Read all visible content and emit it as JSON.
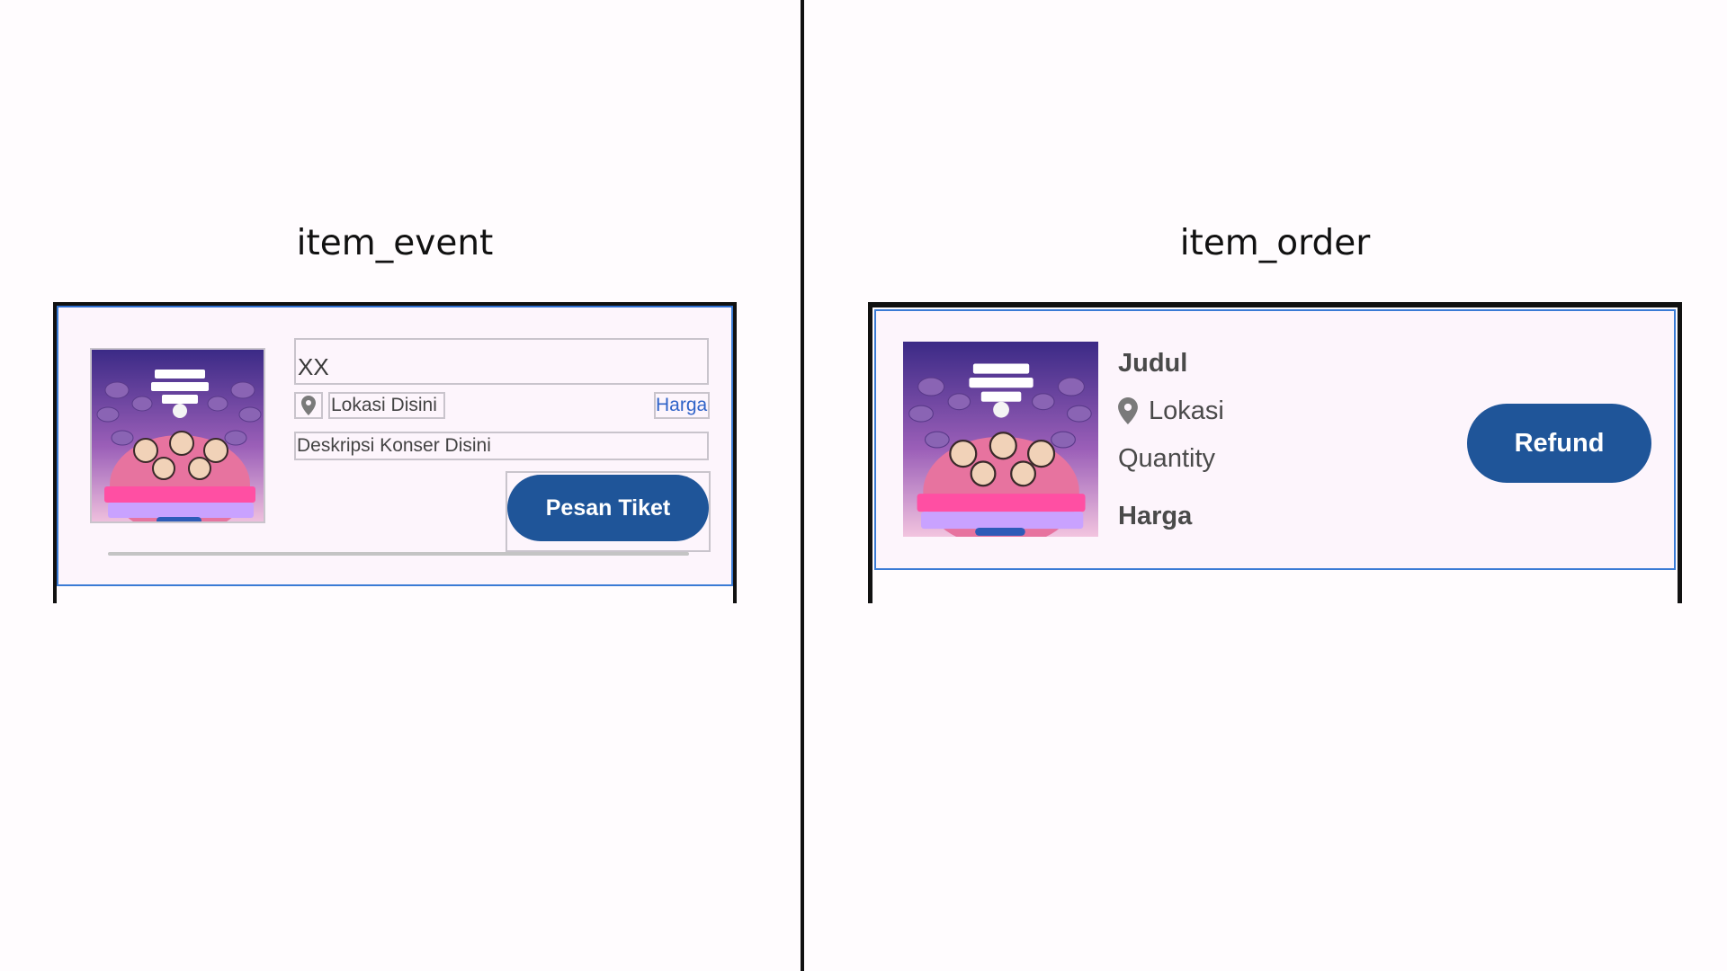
{
  "item_event": {
    "caption": "item_event",
    "title": "XX",
    "location": "Lokasi Disini",
    "price": "Harga",
    "description": "Deskripsi Konser Disini",
    "book_button": "Pesan Tiket",
    "icon": "location-pin-icon"
  },
  "item_order": {
    "caption": "item_order",
    "title": "Judul",
    "location": "Lokasi",
    "quantity": "Quantity",
    "price": "Harga",
    "refund_button": "Refund",
    "icon": "location-pin-icon"
  },
  "colors": {
    "button": "#1f5599",
    "card_background": "#fdf5fc",
    "card_border": "#3a7bd5",
    "divider": "#111111"
  }
}
